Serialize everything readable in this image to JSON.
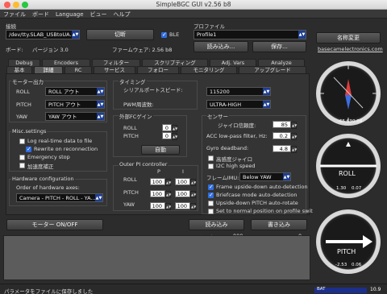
{
  "window": {
    "title": "SimpleBGC GUI v2.56 b8"
  },
  "menu": [
    "ファイル",
    "ボード",
    "Language",
    "ビュー",
    "ヘルプ"
  ],
  "connection": {
    "heading": "接続",
    "port": "/dev/tty.SLAB_USBtoUA...",
    "disconnect": "切断",
    "ble": "BLE",
    "board_label": "ボード:",
    "board_version": "バージョン 3.0",
    "fw_label": "ファームウェア: 2.56 b8"
  },
  "profile": {
    "heading": "プロファイル",
    "selected": "Profile1",
    "rename": "名称変更",
    "load": "読み込み...",
    "save": "保存...",
    "link": "basecamelectronics.com"
  },
  "tabs_row1": [
    "Debug",
    "Encoders",
    "フィルター",
    "スクリプティング",
    "Adj. Vars",
    "Analyze"
  ],
  "tabs_row2": [
    "基本",
    "詳細",
    "RC",
    "サービス",
    "フォロー",
    "モニタリング",
    "アップグレード"
  ],
  "motor_output": {
    "heading": "モーター出力",
    "roll_label": "ROLL",
    "roll": "ROLL アウト",
    "pitch_label": "PITCH",
    "pitch": "PITCH アウト",
    "yaw_label": "YAW",
    "yaw": "YAW アウト"
  },
  "misc": {
    "heading": "Misc.settings",
    "log": "Log real-time data to file",
    "rewrite": "Rewrite on reconnection",
    "estop": "Emergency stop",
    "accel": "加速度補正"
  },
  "hw_config": {
    "heading": "Hardware configuration",
    "order_label": "Order of hardware axes:",
    "order": "Camera - PITCH - ROLL - YA..."
  },
  "timing": {
    "heading": "タイミング",
    "serial_label": "シリアルポートスピード:",
    "serial": "115200",
    "pwm_label": "PWM周波数:",
    "pwm": "ULTRA-HIGH"
  },
  "ext_fc": {
    "heading": "外部FCゲイン",
    "roll_label": "ROLL",
    "roll": "0",
    "pitch_label": "PITCH",
    "pitch": "0",
    "auto": "自動"
  },
  "outer_pi": {
    "heading": "Outer PI controller",
    "p_label": "P",
    "i_label": "I",
    "roll_label": "ROLL",
    "roll_p": "100",
    "roll_i": "100",
    "pitch_label": "PITCH",
    "pitch_p": "100",
    "pitch_i": "100",
    "yaw_label": "YAW",
    "yaw_p": "100",
    "yaw_i": "100"
  },
  "sensor": {
    "heading": "センサー",
    "gyro_trust_label": "ジャイロ信頼度:",
    "gyro_trust": "85",
    "acc_lpf_label": "ACC low-pass filter, Hz:",
    "acc_lpf": "0.2",
    "gyro_dead_label": "Gyro deadband:",
    "gyro_dead": "4.8",
    "frame_imu_label": "フレームIMU:",
    "frame_imu": "Below YAW",
    "hp_gyro": "高感度ジャイロ",
    "i2c_hs": "I2C high speed",
    "frame_ud": "Frame upside-down auto-detection",
    "briefcase": "Briefcase mode auto-detection",
    "upside_pitch": "Upside-down PITCH auto-rotate",
    "set_normal": "Set to normal position on profile swit"
  },
  "bottom": {
    "motor_btn": "モーター ON/OFF",
    "read": "読み込み",
    "write": "書き込み",
    "cycle_label": "サイクルタイム:",
    "cycle": "800",
    "i2c_label": "I2C エラー:",
    "i2c": "0"
  },
  "status": {
    "text": "パラメータをファイルに保存しました",
    "bat_label": "BAT",
    "bat_value": "10.9"
  },
  "gauges": {
    "yaw_values": [
      "-65.63",
      "0.04"
    ],
    "roll_label": "ROLL",
    "roll_values": [
      "1.30",
      "0.07"
    ],
    "pitch_label": "PITCH",
    "pitch_values": [
      "-2.53",
      "0.06"
    ]
  },
  "colors": {
    "accent": "#2f6de0",
    "combo_arrow": "#1c3d91",
    "bat_bar": "#1c2f8a"
  }
}
